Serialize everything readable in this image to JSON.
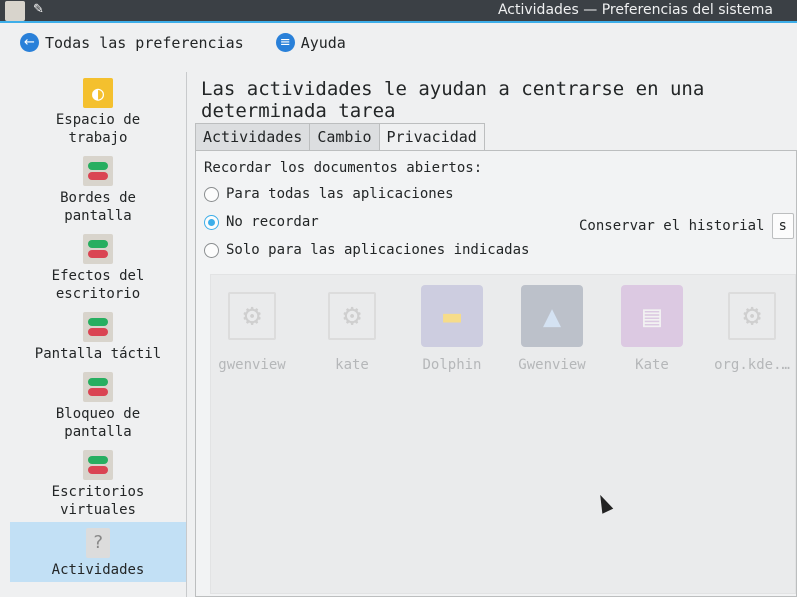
{
  "window": {
    "title": "Actividades — Preferencias del sistema"
  },
  "toolbar": {
    "back_label": "Todas las preferencias",
    "help_label": "Ayuda"
  },
  "sidebar": {
    "items": [
      {
        "label": "Espacio de\ntrabajo",
        "icon": "workspace-icon"
      },
      {
        "label": "Bordes de\npantalla",
        "icon": "toggle-icon"
      },
      {
        "label": "Efectos del\nescritorio",
        "icon": "toggle-icon"
      },
      {
        "label": "Pantalla táctil",
        "icon": "toggle-icon"
      },
      {
        "label": "Bloqueo de\npantalla",
        "icon": "toggle-icon"
      },
      {
        "label": "Escritorios\nvirtuales",
        "icon": "toggle-icon"
      },
      {
        "label": "Actividades",
        "icon": "unknown-icon",
        "selected": true
      }
    ]
  },
  "main": {
    "heading": "Las actividades le ayudan a centrarse en una determinada tarea",
    "tabs": [
      {
        "label": "Actividades"
      },
      {
        "label": "Cambio"
      },
      {
        "label": "Privacidad",
        "active": true
      }
    ],
    "privacy": {
      "remember_label": "Recordar los documentos abiertos:",
      "options": [
        {
          "label": "Para todas las aplicaciones"
        },
        {
          "label": "No recordar",
          "checked": true
        },
        {
          "label": "Solo para las aplicaciones indicadas"
        }
      ],
      "history_label": "Conservar el historial",
      "history_value": "s",
      "apps": [
        {
          "name": "gwenview",
          "icon": "gear-icon"
        },
        {
          "name": "kate",
          "icon": "gear-icon"
        },
        {
          "name": "Dolphin",
          "icon": "folder-icon"
        },
        {
          "name": "Gwenview",
          "icon": "image-icon"
        },
        {
          "name": "Kate",
          "icon": "document-icon"
        },
        {
          "name": "org.kde.…",
          "icon": "gear-icon"
        }
      ]
    }
  },
  "colors": {
    "accent": "#3daee9",
    "selection": "#c2e0f5",
    "titlebar": "#3b4045"
  }
}
